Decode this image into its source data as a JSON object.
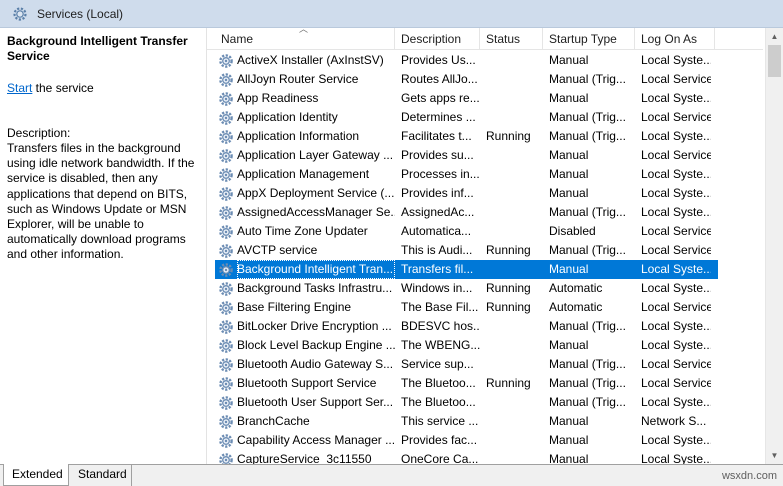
{
  "window": {
    "title": "Services (Local)",
    "icon": "gear-icon"
  },
  "description_pane": {
    "service_title": "Background Intelligent Transfer Service",
    "start_link": "Start",
    "start_suffix": " the service",
    "description_label": "Description:",
    "description_text": "Transfers files in the background using idle network bandwidth. If the service is disabled, then any applications that depend on BITS, such as Windows Update or MSN Explorer, will be unable to automatically download programs and other information."
  },
  "columns": {
    "name": "Name",
    "description": "Description",
    "status": "Status",
    "startup_type": "Startup Type",
    "log_on_as": "Log On As"
  },
  "selected_index": 11,
  "services": [
    {
      "name": "ActiveX Installer (AxInstSV)",
      "description": "Provides Us...",
      "status": "",
      "startup": "Manual",
      "logon": "Local Syste..."
    },
    {
      "name": "AllJoyn Router Service",
      "description": "Routes AllJo...",
      "status": "",
      "startup": "Manual (Trig...",
      "logon": "Local Service"
    },
    {
      "name": "App Readiness",
      "description": "Gets apps re...",
      "status": "",
      "startup": "Manual",
      "logon": "Local Syste..."
    },
    {
      "name": "Application Identity",
      "description": "Determines ...",
      "status": "",
      "startup": "Manual (Trig...",
      "logon": "Local Service"
    },
    {
      "name": "Application Information",
      "description": "Facilitates t...",
      "status": "Running",
      "startup": "Manual (Trig...",
      "logon": "Local Syste..."
    },
    {
      "name": "Application Layer Gateway ...",
      "description": "Provides su...",
      "status": "",
      "startup": "Manual",
      "logon": "Local Service"
    },
    {
      "name": "Application Management",
      "description": "Processes in...",
      "status": "",
      "startup": "Manual",
      "logon": "Local Syste..."
    },
    {
      "name": "AppX Deployment Service (...",
      "description": "Provides inf...",
      "status": "",
      "startup": "Manual",
      "logon": "Local Syste..."
    },
    {
      "name": "AssignedAccessManager Se...",
      "description": "AssignedAc...",
      "status": "",
      "startup": "Manual (Trig...",
      "logon": "Local Syste..."
    },
    {
      "name": "Auto Time Zone Updater",
      "description": "Automatica...",
      "status": "",
      "startup": "Disabled",
      "logon": "Local Service"
    },
    {
      "name": "AVCTP service",
      "description": "This is Audi...",
      "status": "Running",
      "startup": "Manual (Trig...",
      "logon": "Local Service"
    },
    {
      "name": "Background Intelligent Tran...",
      "description": "Transfers fil...",
      "status": "",
      "startup": "Manual",
      "logon": "Local Syste..."
    },
    {
      "name": "Background Tasks Infrastru...",
      "description": "Windows in...",
      "status": "Running",
      "startup": "Automatic",
      "logon": "Local Syste..."
    },
    {
      "name": "Base Filtering Engine",
      "description": "The Base Fil...",
      "status": "Running",
      "startup": "Automatic",
      "logon": "Local Service"
    },
    {
      "name": "BitLocker Drive Encryption ...",
      "description": "BDESVC hos...",
      "status": "",
      "startup": "Manual (Trig...",
      "logon": "Local Syste..."
    },
    {
      "name": "Block Level Backup Engine ...",
      "description": "The WBENG...",
      "status": "",
      "startup": "Manual",
      "logon": "Local Syste..."
    },
    {
      "name": "Bluetooth Audio Gateway S...",
      "description": "Service sup...",
      "status": "",
      "startup": "Manual (Trig...",
      "logon": "Local Service"
    },
    {
      "name": "Bluetooth Support Service",
      "description": "The Bluetoo...",
      "status": "Running",
      "startup": "Manual (Trig...",
      "logon": "Local Service"
    },
    {
      "name": "Bluetooth User Support Ser...",
      "description": "The Bluetoo...",
      "status": "",
      "startup": "Manual (Trig...",
      "logon": "Local Syste..."
    },
    {
      "name": "BranchCache",
      "description": "This service ...",
      "status": "",
      "startup": "Manual",
      "logon": "Network S..."
    },
    {
      "name": "Capability Access Manager ...",
      "description": "Provides fac...",
      "status": "",
      "startup": "Manual",
      "logon": "Local Syste..."
    },
    {
      "name": "CaptureService_3c11550",
      "description": "OneCore Ca...",
      "status": "",
      "startup": "Manual",
      "logon": "Local Syste..."
    }
  ],
  "tabs": [
    "Extended",
    "Standard"
  ],
  "watermark": "wsxdn.com"
}
